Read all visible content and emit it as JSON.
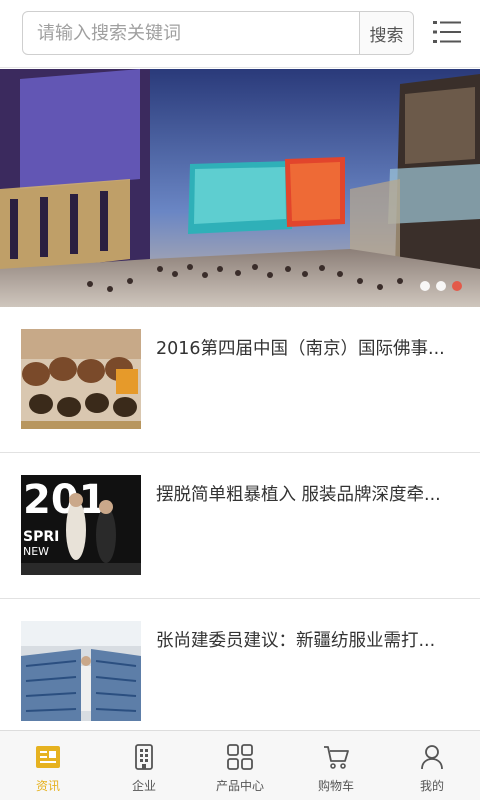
{
  "search": {
    "placeholder": "请输入搜索关键词",
    "button_label": "搜索"
  },
  "banner": {
    "slide_count": 3,
    "active_slide": 3
  },
  "news": [
    {
      "title": "2016第四届中国（南京）国际佛事..."
    },
    {
      "title": "摆脱简单粗暴植入 服装品牌深度牵..."
    },
    {
      "title": "张尚建委员建议：新疆纺服业需打..."
    }
  ],
  "nav": {
    "items": [
      {
        "label": "资讯",
        "icon": "news-icon",
        "active": true
      },
      {
        "label": "企业",
        "icon": "building-icon",
        "active": false
      },
      {
        "label": "产品中心",
        "icon": "grid-icon",
        "active": false
      },
      {
        "label": "购物车",
        "icon": "cart-icon",
        "active": false
      },
      {
        "label": "我的",
        "icon": "user-icon",
        "active": false
      }
    ]
  },
  "colors": {
    "accent": "#e6b220",
    "active_dot": "#e35a4a"
  }
}
